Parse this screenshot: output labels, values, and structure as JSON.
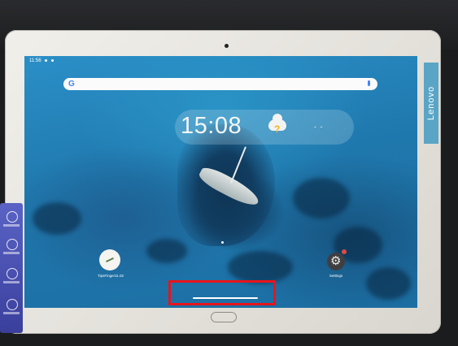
{
  "status_bar": {
    "time": "11:56"
  },
  "brand": {
    "name": "Lenovo"
  },
  "search": {
    "logo": "G"
  },
  "widget": {
    "time": "15:08",
    "weather_icon": "partly-cloudy-icon",
    "temperature": "- -"
  },
  "apps": [
    {
      "label": "TipsFinger11.02",
      "icon": "notes-app-icon"
    },
    {
      "label": "Settings",
      "icon": "gear-icon"
    }
  ],
  "navigation": {
    "gesture_bar": "home-gesture-bar",
    "highlight_color": "#e8141c"
  },
  "colors": {
    "wallpaper": "#1f78ad",
    "tablet_frame": "#ece9e3",
    "strip": "#4a51b3"
  }
}
